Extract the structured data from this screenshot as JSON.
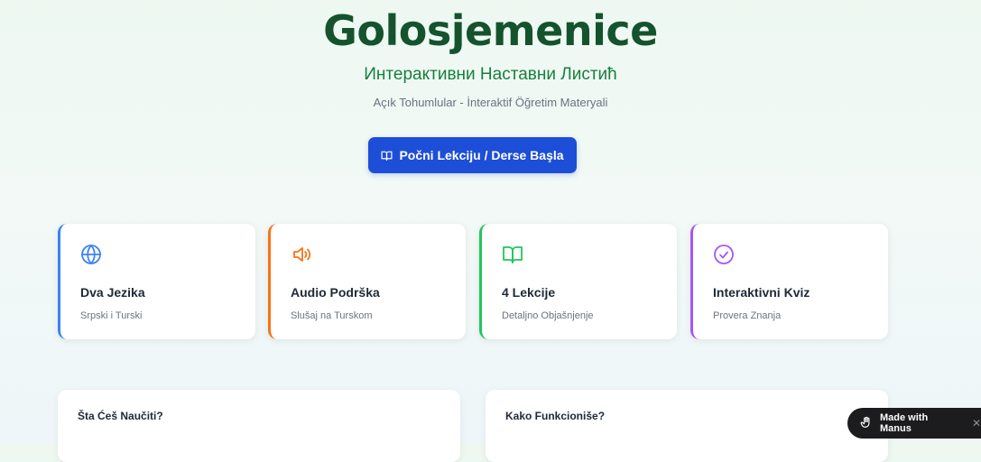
{
  "hero": {
    "title": "Golosjemenice",
    "subtitle": "Интерактивни Наставни Листић",
    "subtitle_tr": "Açık Tohumlular - İnteraktif Öğretim Materyali",
    "start_button": "Počni Lekciju / Derse Başla"
  },
  "features": [
    {
      "icon": "globe-icon",
      "title": "Dva Jezika",
      "sub": "Srpski i Turski",
      "color": "#3b82f6"
    },
    {
      "icon": "speaker-icon",
      "title": "Audio Podrška",
      "sub": "Slušaj na Turskom",
      "color": "#f97316"
    },
    {
      "icon": "book-icon",
      "title": "4 Lekcije",
      "sub": "Detaljno Objašnjenje",
      "color": "#22c55e"
    },
    {
      "icon": "check-circle-icon",
      "title": "Interaktivni Kviz",
      "sub": "Provera Znanja",
      "color": "#a855f7"
    }
  ],
  "panels": {
    "learn_title": "Šta Ćeš Naučiti?",
    "how_title": "Kako Funkcioniše?"
  },
  "badge": {
    "label": "Made with Manus",
    "close": "✕"
  }
}
